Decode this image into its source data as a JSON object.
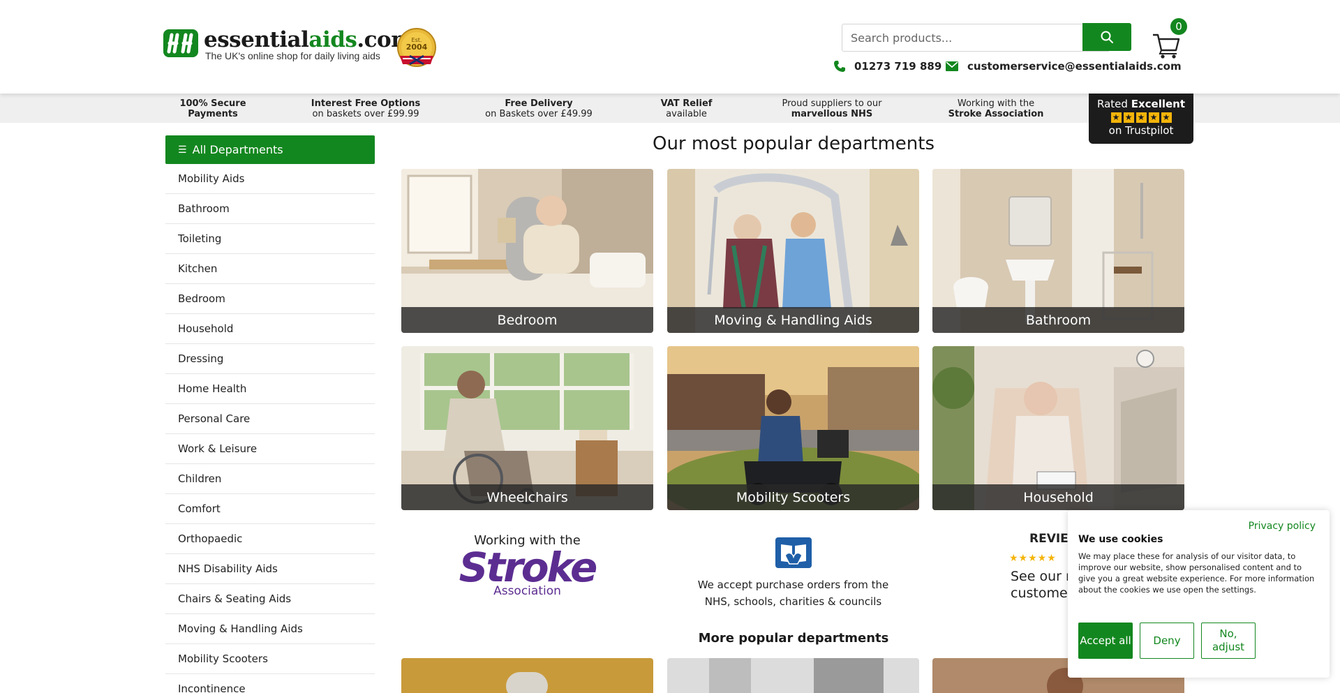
{
  "header": {
    "logo_name_prefix": "essential",
    "logo_name_accent": "aids",
    "logo_name_suffix": ".com",
    "logo_tagline": "The UK's online shop for daily living aids",
    "est_badge_top": "Est.",
    "est_badge_year": "2004",
    "search_placeholder": "Search products...",
    "cart_count": "0",
    "phone": "01273 719 889",
    "email": "customerservice@essentialaids.com"
  },
  "usp_bar": [
    {
      "line1": "100% Secure",
      "line2": "Payments"
    },
    {
      "line1": "Interest Free Options",
      "line2": "on baskets over £99.99"
    },
    {
      "line1": "Free Delivery",
      "line2": "on Baskets over £49.99"
    },
    {
      "line1": "VAT Relief",
      "line2": "available"
    },
    {
      "line1": "Proud suppliers to our",
      "line2": "marvellous NHS"
    },
    {
      "line1": "Working with the",
      "line2": "Stroke Association"
    }
  ],
  "trustpilot": {
    "rated": "Rated",
    "rating_word": "Excellent",
    "on": "on Trustpilot"
  },
  "sidebar": {
    "header_icon": "bars-icon",
    "header_label": "All Departments",
    "items": [
      "Mobility Aids",
      "Bathroom",
      "Toileting",
      "Kitchen",
      "Bedroom",
      "Household",
      "Dressing",
      "Home Health",
      "Personal Care",
      "Work & Leisure",
      "Children",
      "Comfort",
      "Orthopaedic",
      "NHS Disability Aids",
      "Chairs & Seating Aids",
      "Moving & Handling Aids",
      "Mobility Scooters",
      "Incontinence"
    ]
  },
  "main": {
    "title": "Our most popular departments",
    "tiles": [
      "Bedroom",
      "Moving & Handling Aids",
      "Bathroom",
      "Wheelchairs",
      "Mobility Scooters",
      "Household"
    ],
    "stroke_top": "Working with the",
    "stroke_word": "Stroke",
    "stroke_assoc": "Association",
    "po_line1": "We accept purchase orders from the",
    "po_line2": "NHS, schools, charities & councils",
    "reviews_title": "REVIEW",
    "reviews_stars": "★★★★★",
    "reviews_text_1": "See our re",
    "reviews_text_2": "customer re",
    "more_title": "More popular departments"
  },
  "cookie": {
    "privacy_link": "Privacy policy",
    "title": "We use cookies",
    "text": "We may place these for analysis of our visitor data, to improve our website, show personalised content and to give you a great website experience. For more information about the cookies we use open the settings.",
    "accept": "Accept all",
    "deny": "Deny",
    "adjust": "No, adjust"
  },
  "colors": {
    "brand_green": "#13871f",
    "dark": "#1c1c1c",
    "star": "#f4b40a",
    "stroke_purple": "#5c2d91"
  }
}
